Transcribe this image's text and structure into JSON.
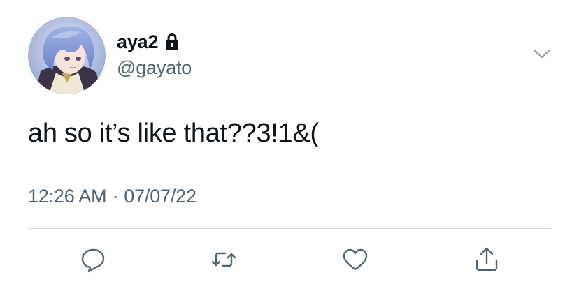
{
  "tweet": {
    "author": {
      "display_name": "aya2",
      "handle": "@gayato",
      "protected_icon": "lock-icon",
      "avatar": "anime-character-avatar"
    },
    "text": "ah so it’s like that??3!1&(",
    "time": "12:26 AM",
    "separator": "·",
    "date": "07/07/22"
  },
  "actions": {
    "reply_icon": "speech-bubble-icon",
    "retweet_icon": "retweet-arrows-icon",
    "like_icon": "heart-icon",
    "share_icon": "share-upload-icon"
  },
  "colors": {
    "text_primary": "#0f1419",
    "text_secondary": "#536471",
    "divider": "#cfd9de",
    "icon": "#536471"
  }
}
